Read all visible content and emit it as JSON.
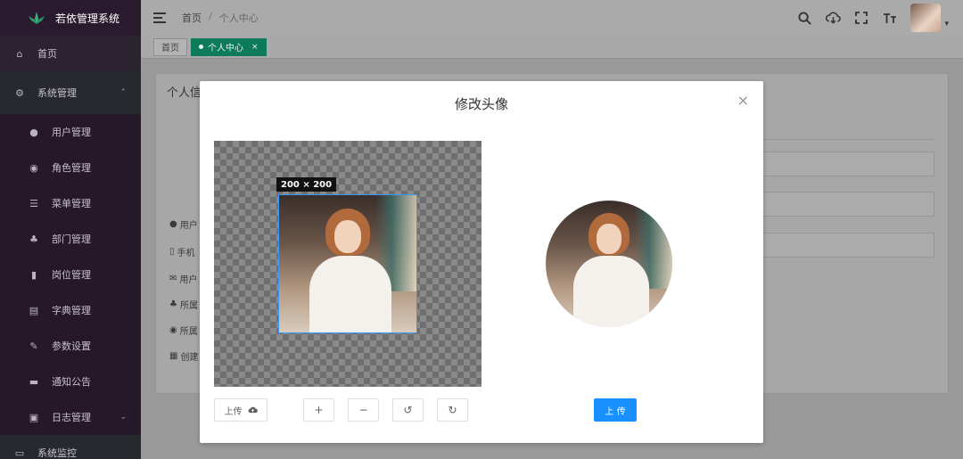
{
  "app": {
    "title": "若依管理系统"
  },
  "sidebar": {
    "items": [
      {
        "label": "首页",
        "icon": "home-icon",
        "level": "top"
      },
      {
        "label": "系统管理",
        "icon": "gear-icon",
        "level": "group",
        "expanded": true
      },
      {
        "label": "用户管理",
        "icon": "user-icon",
        "level": "sub"
      },
      {
        "label": "角色管理",
        "icon": "role-icon",
        "level": "sub"
      },
      {
        "label": "菜单管理",
        "icon": "menu-tree-icon",
        "level": "sub"
      },
      {
        "label": "部门管理",
        "icon": "department-icon",
        "level": "sub"
      },
      {
        "label": "岗位管理",
        "icon": "post-icon",
        "level": "sub"
      },
      {
        "label": "字典管理",
        "icon": "dictionary-icon",
        "level": "sub"
      },
      {
        "label": "参数设置",
        "icon": "edit-icon",
        "level": "sub"
      },
      {
        "label": "通知公告",
        "icon": "message-icon",
        "level": "sub"
      },
      {
        "label": "日志管理",
        "icon": "log-icon",
        "level": "sub"
      },
      {
        "label": "系统监控",
        "icon": "monitor-icon",
        "level": "group"
      }
    ]
  },
  "header": {
    "breadcrumb": [
      "首页",
      "个人中心"
    ],
    "breadcrumb_sep": "/"
  },
  "tags": {
    "items": [
      {
        "label": "首页",
        "active": false
      },
      {
        "label": "个人中心",
        "active": true
      }
    ],
    "close": "×"
  },
  "background": {
    "card_title": "个人信",
    "labels": [
      "用户",
      "手机",
      "用户",
      "所属",
      "所属",
      "创建"
    ]
  },
  "modal": {
    "title": "修改头像",
    "close": "×",
    "crop_info": "200 × 200",
    "buttons": {
      "upload_choose": "上传",
      "zoom_in": "+",
      "zoom_out": "−",
      "rotate_left": "↺",
      "rotate_right": "↻",
      "submit": "上 传"
    }
  },
  "colors": {
    "sidebar_bg": "#2f1f33",
    "active_tag": "#0d7a5a",
    "primary": "#1890ff"
  }
}
